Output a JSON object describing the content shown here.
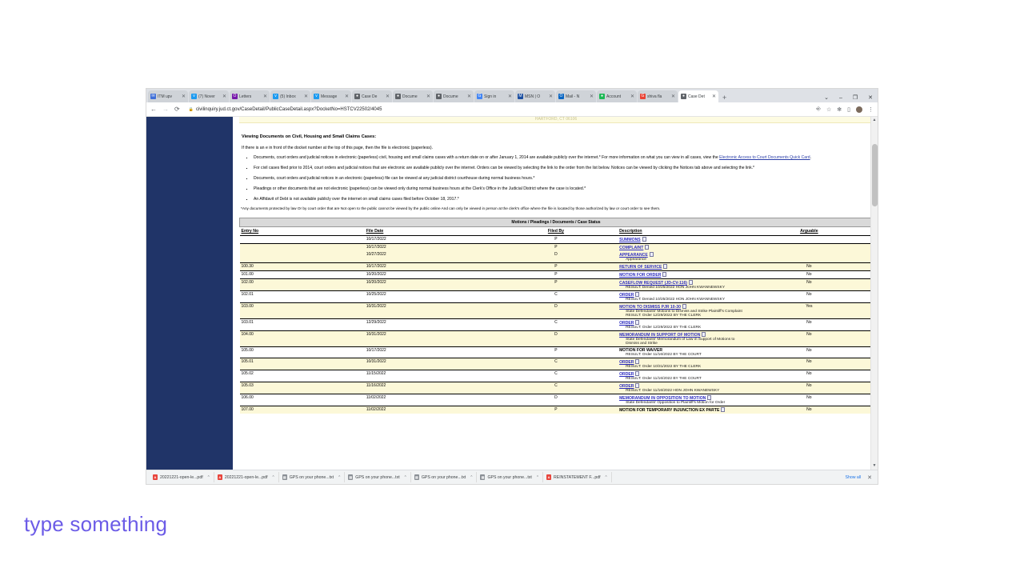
{
  "browser": {
    "tabs": [
      {
        "label": "ITM upv",
        "favicon": "mail-icon",
        "color": "#3f6fd8"
      },
      {
        "label": "(7) Nover",
        "favicon": "twitter-icon",
        "color": "#1d9bf0"
      },
      {
        "label": "Letters",
        "favicon": "outlook-icon",
        "color": "#7719aa"
      },
      {
        "label": "(5) Inbox",
        "favicon": "twitter-icon",
        "color": "#1d9bf0"
      },
      {
        "label": "Message",
        "favicon": "twitter-icon",
        "color": "#1d9bf0"
      },
      {
        "label": "Case De",
        "favicon": "globe-icon",
        "color": "#5f6368"
      },
      {
        "label": "Docume",
        "favicon": "globe-icon",
        "color": "#5f6368"
      },
      {
        "label": "Docume",
        "favicon": "globe-icon",
        "color": "#5f6368"
      },
      {
        "label": "Sign in",
        "favicon": "google-icon",
        "color": "#4285f4"
      },
      {
        "label": "MSN | O",
        "favicon": "msn-icon",
        "color": "#1b4ea0"
      },
      {
        "label": "Mail - N",
        "favicon": "outlook-icon",
        "color": "#0a66c2"
      },
      {
        "label": "Account",
        "favicon": "spotify-icon",
        "color": "#1db954"
      },
      {
        "label": "shiva fla",
        "favicon": "google-icon",
        "color": "#ea4335"
      },
      {
        "label": "Case Det",
        "favicon": "globe-icon",
        "color": "#5f6368",
        "active": true
      }
    ],
    "new_tab_label": "+",
    "window_controls": {
      "minimize": "–",
      "maximize": "❐",
      "close": "✕",
      "overflow": "⌄"
    },
    "nav": {
      "back": "←",
      "forward": "→",
      "reload": "⟳"
    },
    "url": "civilinquiry.jud.ct.gov/CaseDetail/PublicCaseDetail.aspx?DocketNo=HSTCV22502/4045",
    "lock_icon": "🔒",
    "omnibox_icons": [
      "share-icon",
      "bookmark-star-icon",
      "extensions-icon",
      "sidepanel-icon",
      "profile-avatar",
      "chrome-menu-icon"
    ]
  },
  "page": {
    "banner_text": "HARTFORD, CT 06106",
    "section_title": "Viewing Documents on Civil, Housing and Small Claims Cases:",
    "lead": "If there is an e in front of the docket number at the top of this page, then the file is electronic (paperless).",
    "bullets": [
      {
        "text_before": "Documents, court orders and judicial notices in electronic (paperless) civil, housing and small claims cases with a return date on or after January 1, 2014 are available publicly over the internet.* For more information on what you can view in all cases, view the ",
        "link": "Electronic Access to Court Documents Quick Card",
        "text_after": "."
      },
      {
        "text_before": "For civil cases filed prior to 2014, court orders and judicial notices that are electronic are available publicly over the internet. Orders can be viewed by selecting the link to the order from the list below. Notices can be viewed by clicking the Notices tab above and selecting the link.*",
        "link": "",
        "text_after": ""
      },
      {
        "text_before": "Documents, court orders and judicial notices in an electronic (paperless) file can be viewed at any judicial district courthouse during normal business hours.*",
        "link": "",
        "text_after": ""
      },
      {
        "text_before": "Pleadings or other documents that are not electronic (paperless) can be viewed only during normal business hours at the Clerk's Office in the Judicial District where the case is located.*",
        "link": "",
        "text_after": ""
      },
      {
        "text_before": "An Affidavit of Debt is not available publicly over the internet on small claims cases filed before October 18, 2017.*",
        "link": "",
        "text_after": ""
      }
    ],
    "footnote": "*Any documents protected by law Or by court order that are Not open to the public cannot be viewed by the public online And can only be viewed in person at the clerk's office where the file is located by those authorized by law or court order to see them.",
    "table": {
      "band_header": "Motions / Pleadings / Documents / Case Status",
      "columns": [
        "Entry No",
        "File Date",
        "Filed By",
        "Description",
        "Arguable"
      ],
      "rows": [
        {
          "entry": "",
          "date": "10/17/2022",
          "by": "P",
          "desc": "SUMMONS",
          "link": true,
          "doc": true,
          "sub": [],
          "arg": "",
          "band": "white",
          "sep": true
        },
        {
          "entry": "",
          "date": "10/17/2022",
          "by": "P",
          "desc": "COMPLAINT",
          "link": true,
          "doc": true,
          "sub": [],
          "arg": "",
          "band": "yellow",
          "sep": true
        },
        {
          "entry": "",
          "date": "10/27/2022",
          "by": "D",
          "desc": "APPEARANCE",
          "link": true,
          "doc": true,
          "sub": [
            "Appearance"
          ],
          "arg": "",
          "band": "yellow",
          "sep": false
        },
        {
          "entry": "100.30",
          "date": "10/17/2022",
          "by": "P",
          "desc": "RETURN OF SERVICE",
          "link": true,
          "doc": true,
          "sub": [],
          "arg": "No",
          "band": "yellow",
          "sep": true
        },
        {
          "entry": "101.00",
          "date": "10/20/2022",
          "by": "P",
          "desc": "MOTION FOR ORDER",
          "link": true,
          "doc": true,
          "sub": [],
          "arg": "No",
          "band": "white",
          "sep": true
        },
        {
          "entry": "102.00",
          "date": "10/20/2022",
          "by": "P",
          "desc": "CASEFLOW REQUEST (JD-CV-116)",
          "link": true,
          "doc": true,
          "sub": [
            "RESULT: Denied 10/25/2022 HON JOHN KWANNEWSKY"
          ],
          "arg": "No",
          "band": "yellow",
          "sep": true
        },
        {
          "entry": "102.01",
          "date": "10/25/2022",
          "by": "C",
          "desc": "ORDER",
          "link": true,
          "doc": true,
          "sub": [
            "RESULT: Denied 10/25/2022 HON JOHN KWANNEWSKY"
          ],
          "arg": "No",
          "band": "white",
          "sep": true
        },
        {
          "entry": "103.00",
          "date": "10/31/2022",
          "by": "D",
          "desc": "MOTION TO DISMISS PJR 10-30",
          "link": true,
          "doc": true,
          "sub": [
            "State Defendants' Motions to Dismiss and Strike Plaintiff's Complaint",
            "RESULT: Order 12/29/2022 BY THE CLERK"
          ],
          "arg": "Yes",
          "band": "yellow",
          "sep": true
        },
        {
          "entry": "103.01",
          "date": "12/29/2022",
          "by": "C",
          "desc": "ORDER",
          "link": true,
          "doc": true,
          "sub": [
            "RESULT: Order 12/29/2022 BY THE CLERK"
          ],
          "arg": "No",
          "band": "white",
          "sep": true
        },
        {
          "entry": "104.00",
          "date": "10/31/2022",
          "by": "D",
          "desc": "MEMORANDUM IN SUPPORT OF MOTION",
          "link": true,
          "doc": true,
          "sub": [
            "State Defendants' Memorandum of Law in Support of Motions to Dismiss and Strike"
          ],
          "arg": "No",
          "band": "yellow",
          "sep": true
        },
        {
          "entry": "105.00",
          "date": "10/17/2022",
          "by": "P",
          "desc": "MOTION FOR WAIVER",
          "link": false,
          "doc": false,
          "sub": [
            "RESULT: Order 11/16/2022 BY THE COURT"
          ],
          "arg": "No",
          "band": "white",
          "sep": true
        },
        {
          "entry": "105.01",
          "date": "10/31/2022",
          "by": "C",
          "desc": "ORDER",
          "link": true,
          "doc": true,
          "sub": [
            "RESULT: Order 10/31/2022 BY THE CLERK"
          ],
          "arg": "No",
          "band": "yellow",
          "sep": true
        },
        {
          "entry": "105.02",
          "date": "11/15/2022",
          "by": "C",
          "desc": "ORDER",
          "link": true,
          "doc": true,
          "sub": [
            "RESULT: Order 11/16/2022 BY THE COURT"
          ],
          "arg": "No",
          "band": "white",
          "sep": true
        },
        {
          "entry": "105.03",
          "date": "11/16/2022",
          "by": "C",
          "desc": "ORDER",
          "link": true,
          "doc": true,
          "sub": [
            "RESULT: Order 11/16/2022 HON JOHN KWANEWSKY"
          ],
          "arg": "No",
          "band": "yellow",
          "sep": true
        },
        {
          "entry": "106.00",
          "date": "11/02/2022",
          "by": "D",
          "desc": "MEMORANDUM IN OPPOSITION TO MOTION",
          "link": true,
          "doc": true,
          "sub": [
            "State Defendants' Opposition to Plaintiff's Motion for Order"
          ],
          "arg": "No",
          "band": "white",
          "sep": true
        },
        {
          "entry": "107.00",
          "date": "11/02/2022",
          "by": "P",
          "desc": "MOTION FOR TEMPORARY INJUNCTION EX PARTE",
          "link": false,
          "doc": true,
          "sub": [],
          "arg": "No",
          "band": "yellow",
          "sep": true
        }
      ]
    }
  },
  "downloads": {
    "items": [
      {
        "name": "20221221-open-le...pdf",
        "type": "pdf"
      },
      {
        "name": "20221221-open-le...pdf",
        "type": "pdf"
      },
      {
        "name": "GPS on your phone...txt",
        "type": "txt"
      },
      {
        "name": "GPS on your phone...txt",
        "type": "txt"
      },
      {
        "name": "GPS on your phone...txt",
        "type": "txt"
      },
      {
        "name": "GPS on your phone...txt",
        "type": "txt"
      },
      {
        "name": "REINSTATEMENT F...pdf",
        "type": "pdf"
      }
    ],
    "show_all": "Show all",
    "close": "✕",
    "caret": "⌃"
  },
  "overlay": {
    "prompt_text": "type something",
    "prompt_color": "#6c5ce7",
    "watermark_label": "lexi-logo"
  }
}
